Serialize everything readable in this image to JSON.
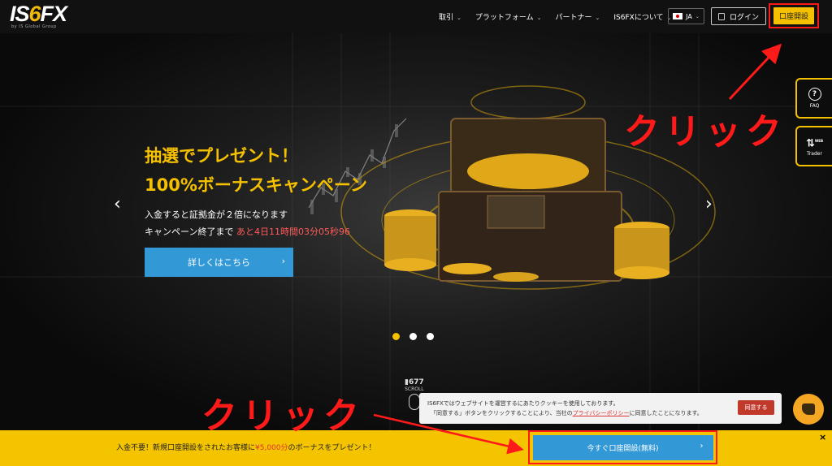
{
  "header": {
    "logo_text": "IS6FX",
    "logo_sub": "by IS Global Group",
    "nav": [
      {
        "label": "取引"
      },
      {
        "label": "プラットフォーム"
      },
      {
        "label": "パートナー"
      },
      {
        "label": "IS6FXについて"
      }
    ],
    "lang": "JA",
    "login": "ログイン",
    "open_account": "口座開設"
  },
  "hero": {
    "headline_1": "抽選でプレゼント！",
    "headline_2": "100%ボーナスキャンペーン",
    "sub_1": "入金すると証拠金が２倍になります",
    "sub_2_prefix": "キャンペーン終了まで",
    "countdown": "あと4日11時間03分05秒96",
    "detail_button": "詳しくはこちら",
    "scroll_num": "677",
    "scroll_label": "SCROLL"
  },
  "side_tabs": {
    "faq": "FAQ",
    "trader_badge": "WEB",
    "trader": "Trader"
  },
  "annotations": {
    "click_top": "クリック",
    "click_bottom": "クリック"
  },
  "cookie": {
    "line1": "IS6FXではウェブサイトを運営するにあたりクッキーを使用しております。",
    "line2_a": "「同意する」ボタンをクリックすることにより、当社の",
    "policy": "プライバシーポリシー",
    "line2_b": "に同意したことになります。",
    "agree": "同意する"
  },
  "banner": {
    "text_a": "入金不要！新規口座開設をされたお客様に",
    "bonus": "¥5,000分",
    "text_b": "のボーナスをプレゼント！",
    "cta": "今すぐ口座開設(無料)",
    "close": "×"
  },
  "colors": {
    "accent": "#f5c000",
    "button_blue": "#3399d6",
    "annotation_red": "#ff1a1a",
    "countdown_red": "#ff5a5a"
  }
}
